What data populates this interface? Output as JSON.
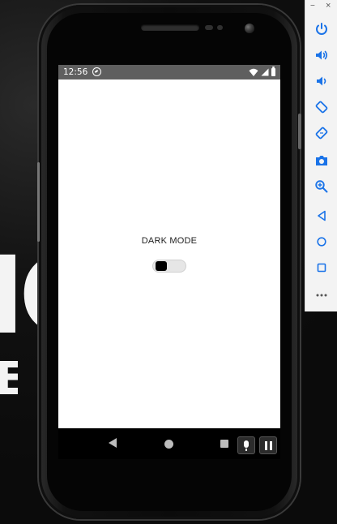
{
  "desktop": {
    "background_text_1": "IC",
    "background_text_2": "E"
  },
  "status_bar": {
    "time": "12:56",
    "background_color": "#5f5f5f"
  },
  "app": {
    "dark_mode_label": "DARK MODE",
    "toggle": {
      "state": "off",
      "track_color": "#e6e6e6",
      "knob_color": "#000000"
    }
  },
  "nav_bar": {
    "buttons": [
      "back-icon",
      "home-icon",
      "recents-icon"
    ],
    "overlay_buttons": [
      "mic-icon",
      "pause-icon"
    ]
  },
  "emulator_toolbar": {
    "minimize_label": "−",
    "close_label": "×",
    "buttons": [
      "power-icon",
      "volume-up-icon",
      "volume-down-icon",
      "rotate-left-icon",
      "rotate-right-icon",
      "camera-icon",
      "zoom-icon",
      "back-icon",
      "home-icon",
      "overview-icon",
      "more-icon"
    ],
    "icon_color": "#1a73e8"
  }
}
